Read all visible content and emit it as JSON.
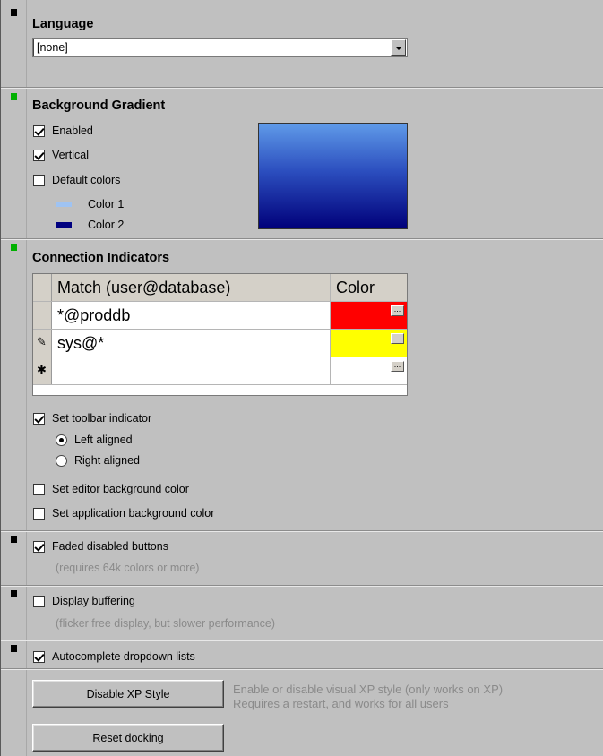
{
  "language": {
    "heading": "Language",
    "selected": "[none]"
  },
  "background_gradient": {
    "heading": "Background Gradient",
    "enabled": {
      "label": "Enabled",
      "checked": true
    },
    "vertical": {
      "label": "Vertical",
      "checked": true
    },
    "default_colors": {
      "label": "Default colors",
      "checked": false
    },
    "color1": {
      "label": "Color 1",
      "color": "#9fc3f2"
    },
    "color2": {
      "label": "Color 2",
      "color": "#000080"
    }
  },
  "connection_indicators": {
    "heading": "Connection Indicators",
    "columns": [
      "Match (user@database)",
      "Color"
    ],
    "rows": [
      {
        "marker": "",
        "match": "*@proddb",
        "color": "#ff0000"
      },
      {
        "marker": "✎",
        "match": "sys@*",
        "color": "#ffff00"
      },
      {
        "marker": "✱",
        "match": "",
        "color": "#ffffff"
      }
    ],
    "ellipsis": "...",
    "set_toolbar_indicator": {
      "label": "Set toolbar indicator",
      "checked": true
    },
    "left_aligned": {
      "label": "Left aligned",
      "selected": true
    },
    "right_aligned": {
      "label": "Right aligned",
      "selected": false
    },
    "set_editor_bg": {
      "label": "Set editor background color",
      "checked": false
    },
    "set_app_bg": {
      "label": "Set application background color",
      "checked": false
    }
  },
  "faded_disabled_buttons": {
    "label": "Faded disabled buttons",
    "checked": true,
    "note": "(requires 64k colors or more)"
  },
  "display_buffering": {
    "label": "Display buffering",
    "checked": false,
    "note": "(flicker free display, but slower performance)"
  },
  "autocomplete": {
    "label": "Autocomplete dropdown lists",
    "checked": true
  },
  "buttons": {
    "disable_xp_style": "Disable XP Style",
    "disable_xp_note_line1": "Enable or disable visual XP style (only works on XP)",
    "disable_xp_note_line2": "Requires a restart, and works for all users",
    "reset_docking": "Reset docking"
  },
  "marker_colors": {
    "black": "#000000",
    "green": "#00b000"
  }
}
